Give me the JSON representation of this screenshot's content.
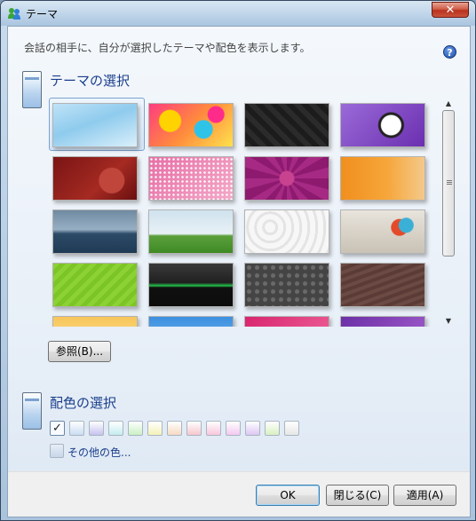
{
  "window": {
    "title": "テーマ",
    "close_glyph": "✕"
  },
  "description": "会話の相手に、自分が選択したテーマや配色を表示します。",
  "help_glyph": "?",
  "theme_section": {
    "title": "テーマの選択",
    "browse_button": "参照(B)...",
    "thumbnails": [
      {
        "name": "sky-light-blue",
        "selected": true
      },
      {
        "name": "colorful-paisley"
      },
      {
        "name": "dark-pattern"
      },
      {
        "name": "purple-skull"
      },
      {
        "name": "red-love-swirl"
      },
      {
        "name": "pink-halftone"
      },
      {
        "name": "magenta-heart"
      },
      {
        "name": "orange-grass"
      },
      {
        "name": "sea-plane"
      },
      {
        "name": "green-field"
      },
      {
        "name": "white-waves"
      },
      {
        "name": "chameleon"
      },
      {
        "name": "lime-stripes"
      },
      {
        "name": "dark-green-wave"
      },
      {
        "name": "gray-damask"
      },
      {
        "name": "brown-lines"
      },
      {
        "name": "yellow-sky"
      },
      {
        "name": "blue-sky"
      },
      {
        "name": "pink-abstract"
      },
      {
        "name": "purple-abstract"
      }
    ]
  },
  "color_section": {
    "title": "配色の選択",
    "check_glyph": "✓",
    "swatches": [
      "#f7fbff",
      "#c9dcf2",
      "#c6c2ef",
      "#c4ecef",
      "#c9f0c4",
      "#f4f2b8",
      "#f6d9c2",
      "#f6c6cc",
      "#f8c6dc",
      "#f3c8f0",
      "#dcc6f3",
      "#d8f0c0",
      "#e6e6e6"
    ],
    "other_colors": "その他の色..."
  },
  "buttons": {
    "ok": "OK",
    "close": "閉じる(C)",
    "apply": "適用(A)"
  },
  "colors": {
    "title_link": "#1a3e8c",
    "accent": "#3c7fb1"
  }
}
